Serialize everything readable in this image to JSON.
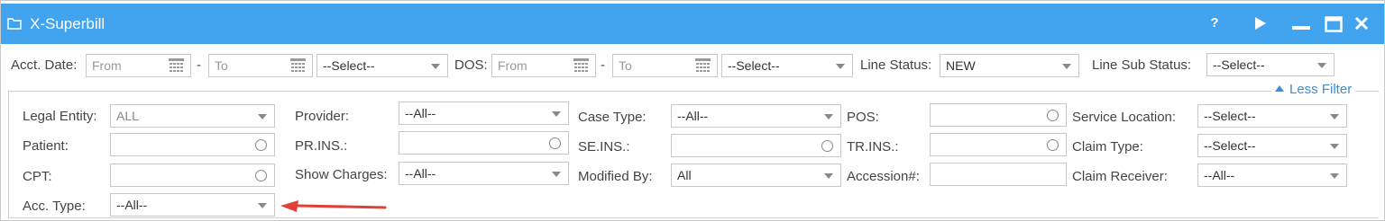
{
  "window": {
    "title": "X-Superbill",
    "folder_icon": "folder-icon"
  },
  "title_controls": {
    "help": "?",
    "icons": [
      "help-icon",
      "play-icon",
      "minimize-icon",
      "maximize-icon",
      "close-icon"
    ]
  },
  "top_filters": {
    "acct_date_label": "Acct. Date:",
    "acct_date_from_placeholder": "From",
    "acct_date_to_placeholder": "To",
    "acct_date_range": "--Select--",
    "dos_label": "DOS:",
    "dos_from_placeholder": "From",
    "dos_to_placeholder": "To",
    "dos_range": "--Select--",
    "line_status_label": "Line Status:",
    "line_status_value": "NEW",
    "line_sub_status_label": "Line Sub Status:",
    "line_sub_status_value": "--Select--",
    "dash": "-"
  },
  "less_filter_label": "Less Filter",
  "filters": {
    "legal_entity_label": "Legal Entity:",
    "legal_entity_value": "ALL",
    "patient_label": "Patient:",
    "patient_value": "",
    "cpt_label": "CPT:",
    "cpt_value": "",
    "acc_type_label": "Acc. Type:",
    "acc_type_value": "--All--",
    "provider_label": "Provider:",
    "provider_value": "--All--",
    "pr_ins_label": "PR.INS.:",
    "pr_ins_value": "",
    "show_charges_label": "Show Charges:",
    "show_charges_value": "--All--",
    "case_type_label": "Case Type:",
    "case_type_value": "--All--",
    "se_ins_label": "SE.INS.:",
    "se_ins_value": "",
    "modified_by_label": "Modified By:",
    "modified_by_value": "All",
    "pos_label": "POS:",
    "pos_value": "",
    "tr_ins_label": "TR.INS.:",
    "tr_ins_value": "",
    "accession_label": "Accession#:",
    "accession_value": "",
    "service_location_label": "Service Location:",
    "service_location_value": "--Select--",
    "claim_type_label": "Claim Type:",
    "claim_type_value": "--Select--",
    "claim_receiver_label": "Claim Receiver:",
    "claim_receiver_value": "--All--"
  },
  "colors": {
    "titlebar": "#42a4ee",
    "link": "#3c8fd6",
    "arrow": "#e0403a"
  }
}
